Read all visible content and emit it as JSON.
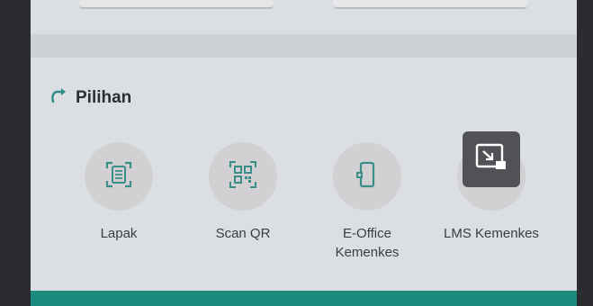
{
  "section": {
    "title": "Pilihan",
    "icon": "share-arrow-icon"
  },
  "menu_items": [
    {
      "label": "Lapak",
      "icon": "document-scan-icon"
    },
    {
      "label": "Scan QR",
      "icon": "qr-code-icon"
    },
    {
      "label": "E-Office\nKemenkes",
      "icon": "mobile-device-icon"
    },
    {
      "label": "LMS Kemenkes",
      "icon": "devices-icon"
    }
  ],
  "colors": {
    "accent_teal": "#1d8a7e",
    "icon_teal": "#3a8f88",
    "background": "#dcdfe2"
  },
  "overlay": {
    "pip_icon": "picture-in-picture-icon"
  }
}
